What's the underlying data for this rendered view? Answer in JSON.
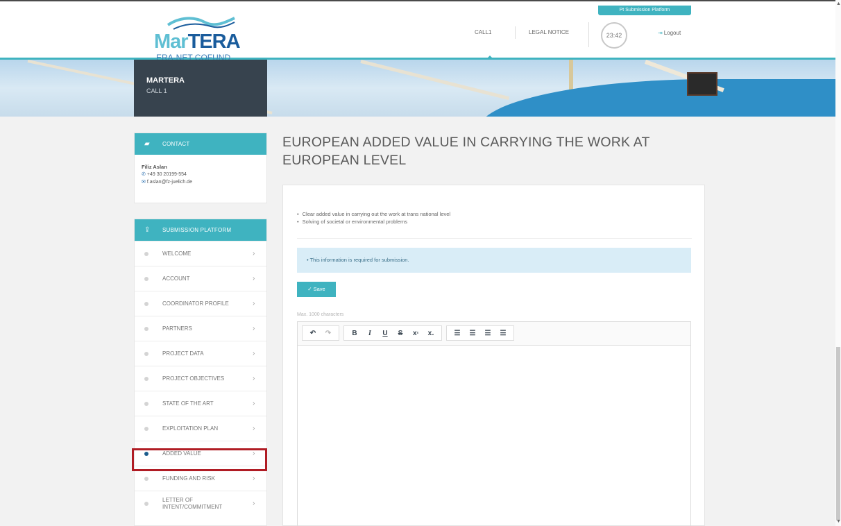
{
  "header": {
    "platform_badge": "Pt Submission Platform",
    "logo_primary": "Mar",
    "logo_secondary": "TERA",
    "logo_sub": "ERA-NET COFUND",
    "nav": {
      "call": "CALL1",
      "legal": "LEGAL NOTICE"
    },
    "timer": "23:42",
    "logout": "Logout"
  },
  "banner": {
    "title": "MARTERA",
    "subtitle": "CALL 1"
  },
  "contact": {
    "heading": "CONTACT",
    "name": "Filiz Aslan",
    "phone": "+49 30 20199-554",
    "email": "f.aslan@fz-juelich.de"
  },
  "submission": {
    "heading": "SUBMISSION PLATFORM",
    "items": [
      {
        "label": "WELCOME",
        "active": false
      },
      {
        "label": "ACCOUNT",
        "active": false
      },
      {
        "label": "COORDINATOR PROFILE",
        "active": false
      },
      {
        "label": "PARTNERS",
        "active": false
      },
      {
        "label": "PROJECT DATA",
        "active": false
      },
      {
        "label": "PROJECT OBJECTIVES",
        "active": false
      },
      {
        "label": "STATE OF THE ART",
        "active": false
      },
      {
        "label": "EXPLOITATION PLAN",
        "active": false
      },
      {
        "label": "ADDED VALUE",
        "active": true
      },
      {
        "label": "FUNDING AND RISK",
        "active": false
      },
      {
        "label": "LETTER OF INTENT/COMMITMENT",
        "active": false
      }
    ]
  },
  "main": {
    "title": "EUROPEAN ADDED VALUE IN CARRYING THE WORK AT EUROPEAN LEVEL",
    "bullets": [
      "Clear added value in carrying out the work at trans national level",
      "Solving of societal or environmental problems"
    ],
    "info": "This information is required for submission.",
    "save_label": "Save",
    "max_chars": "Max. 1000 characters"
  },
  "colors": {
    "accent": "#3fb3c0",
    "dark_panel": "#37434e",
    "highlight": "#b01c24",
    "active_dot": "#1c5c8c"
  }
}
